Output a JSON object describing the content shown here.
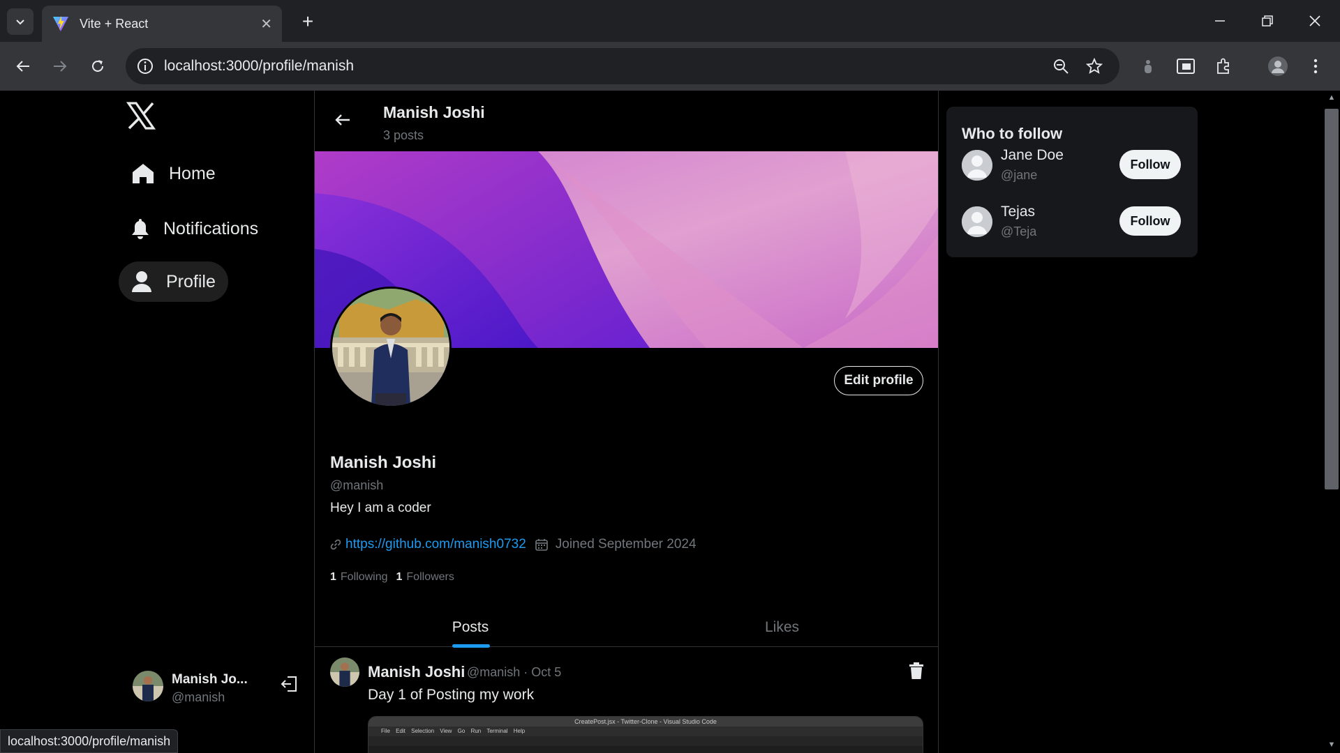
{
  "browser": {
    "tab_title": "Vite + React",
    "url": "localhost:3000/profile/manish",
    "status_url": "localhost:3000/profile/manish"
  },
  "sidebar": {
    "items": [
      {
        "label": "Home",
        "icon": "home-icon"
      },
      {
        "label": "Notifications",
        "icon": "bell-icon"
      },
      {
        "label": "Profile",
        "icon": "user-icon",
        "active": true
      }
    ],
    "account": {
      "name": "Manish Jo...",
      "handle": "@manish"
    }
  },
  "header": {
    "name": "Manish Joshi",
    "post_count": "3 posts"
  },
  "profile": {
    "edit_label": "Edit profile",
    "name": "Manish Joshi",
    "handle": "@manish",
    "bio": "Hey I am a coder",
    "link": "https://github.com/manish0732",
    "joined": "Joined September 2024",
    "following_count": "1",
    "following_label": "Following",
    "followers_count": "1",
    "followers_label": "Followers"
  },
  "tabs": {
    "posts": "Posts",
    "likes": "Likes"
  },
  "post": {
    "name": "Manish Joshi",
    "meta": "@manish · Oct 5",
    "text": "Day 1 of Posting my work",
    "image_title": "CreatePost.jsx - Twitter-Clone - Visual Studio Code",
    "image_menu": "File Edit Selection View Go Run Terminal Help"
  },
  "who_to_follow": {
    "title": "Who to follow",
    "users": [
      {
        "name": "Jane Doe",
        "handle": "@jane",
        "button": "Follow"
      },
      {
        "name": "Tejas",
        "handle": "@Teja",
        "button": "Follow"
      }
    ]
  },
  "colors": {
    "accent": "#1d9bf0",
    "background": "#000000",
    "muted": "#71767b"
  }
}
